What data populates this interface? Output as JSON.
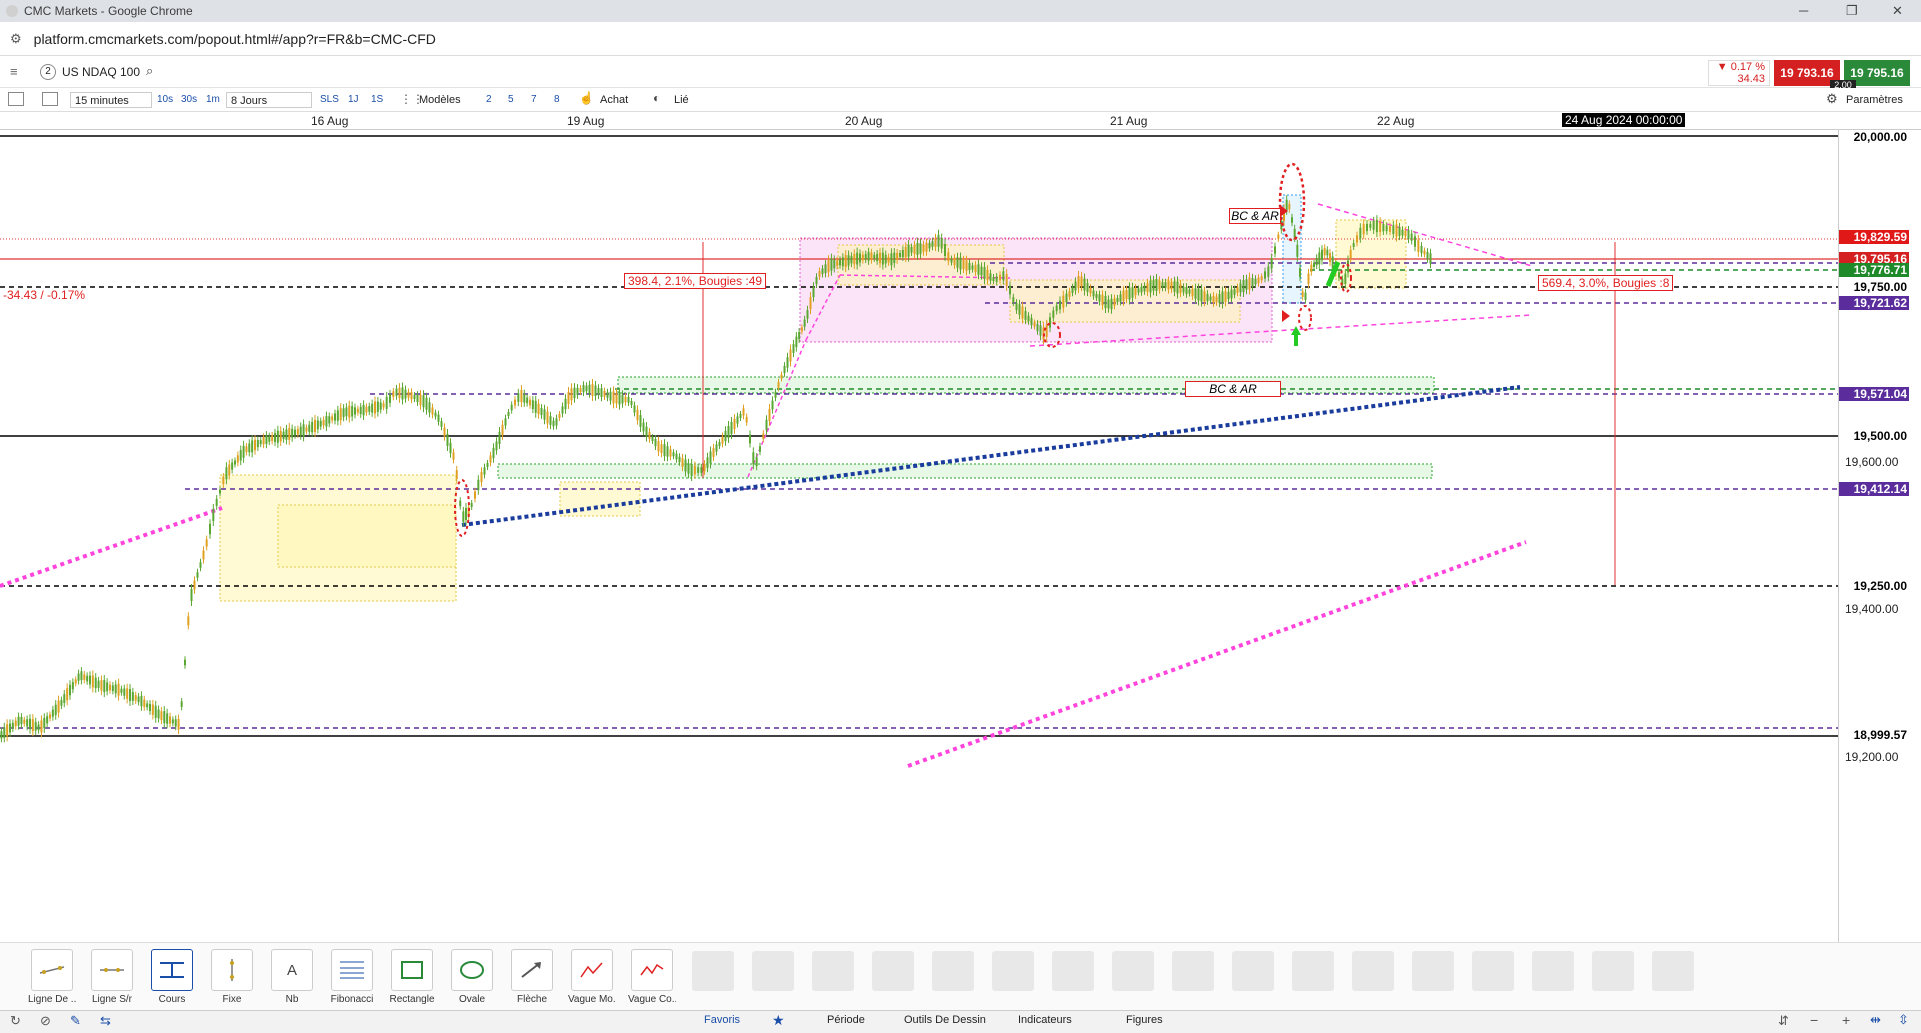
{
  "window": {
    "title": "CMC Markets - Google Chrome",
    "controls": [
      "─",
      "❐",
      "✕"
    ]
  },
  "address": {
    "url": "platform.cmcmarkets.com/popout.html#/app?r=FR&b=CMC-CFD"
  },
  "instrument": {
    "number": "2",
    "name": "US NDAQ 100"
  },
  "quote": {
    "change_pct": "▼ 0.17 %",
    "change_abs": "34.43",
    "sell": "19 793.16",
    "buy": "19 795.16",
    "spread": "2.00"
  },
  "toolbar": {
    "interval": "15 minutes",
    "quick_intervals": [
      "10s",
      "30s",
      "1m"
    ],
    "period": "8 Jours",
    "mode_buttons": [
      "SLS",
      "1J",
      "1S"
    ],
    "templates_label": "Modèles",
    "level_buttons": [
      "2",
      "5",
      "7",
      "8"
    ],
    "buy_label": "Achat",
    "linked_label": "Lié",
    "settings_label": "Paramètres"
  },
  "date_axis": {
    "labels": [
      "16 Aug",
      "19 Aug",
      "20 Aug",
      "21 Aug",
      "22 Aug"
    ],
    "cursor_label": "24 Aug 2024 00:00:00"
  },
  "price_axis": {
    "ticks": [
      "20,000.00",
      "19,600.00",
      "19,500.00",
      "19,400.00",
      "19,250.00",
      "19,200.00"
    ],
    "markers": [
      {
        "value": "20,000.00",
        "bg": "#ffffff",
        "fg": "#000000"
      },
      {
        "value": "19,829.59",
        "bg": "#e01818",
        "fg": "#ffffff"
      },
      {
        "value": "19,795.16",
        "bg": "#d42020",
        "fg": "#ffffff"
      },
      {
        "value": "19,776.71",
        "bg": "#1f8a2a",
        "fg": "#ffffff"
      },
      {
        "value": "19,750.00",
        "bg": "#ffffff",
        "fg": "#000000"
      },
      {
        "value": "19,721.62",
        "bg": "#5b2d9c",
        "fg": "#ffffff"
      },
      {
        "value": "19,571.04",
        "bg": "#5b2d9c",
        "fg": "#ffffff"
      },
      {
        "value": "19,500.00",
        "bg": "#ffffff",
        "fg": "#000000"
      },
      {
        "value": "19,412.14",
        "bg": "#5b2d9c",
        "fg": "#ffffff"
      },
      {
        "value": "19,250.00",
        "bg": "#ffffff",
        "fg": "#000000"
      },
      {
        "value": "18,999.57",
        "bg": "#ffffff",
        "fg": "#000000"
      }
    ]
  },
  "annotations": {
    "change_label": "-34.43 / -0.17%",
    "measure1": "398.4, 2.1%, Bougies :49",
    "measure2": "569.4, 3.0%, Bougies :8",
    "bcar1": "BC & AR",
    "bcar2": "BC & AR"
  },
  "tools": [
    "Ligne De ...",
    "Ligne S/r",
    "Cours",
    "Fixe",
    "Nb",
    "Fibonacci",
    "Rectangle",
    "Ovale",
    "Flèche",
    "Vague Mo...",
    "Vague Co..."
  ],
  "bottom_tabs": [
    "Favoris",
    "Période",
    "Outils De Dessin",
    "Indicateurs",
    "Figures"
  ],
  "colors": {
    "up": "#5aa832",
    "down": "#e0a020",
    "pink_line": "#ff44dd",
    "navy_line": "#1a3c9c",
    "accent_blue": "#1a4ea8"
  }
}
